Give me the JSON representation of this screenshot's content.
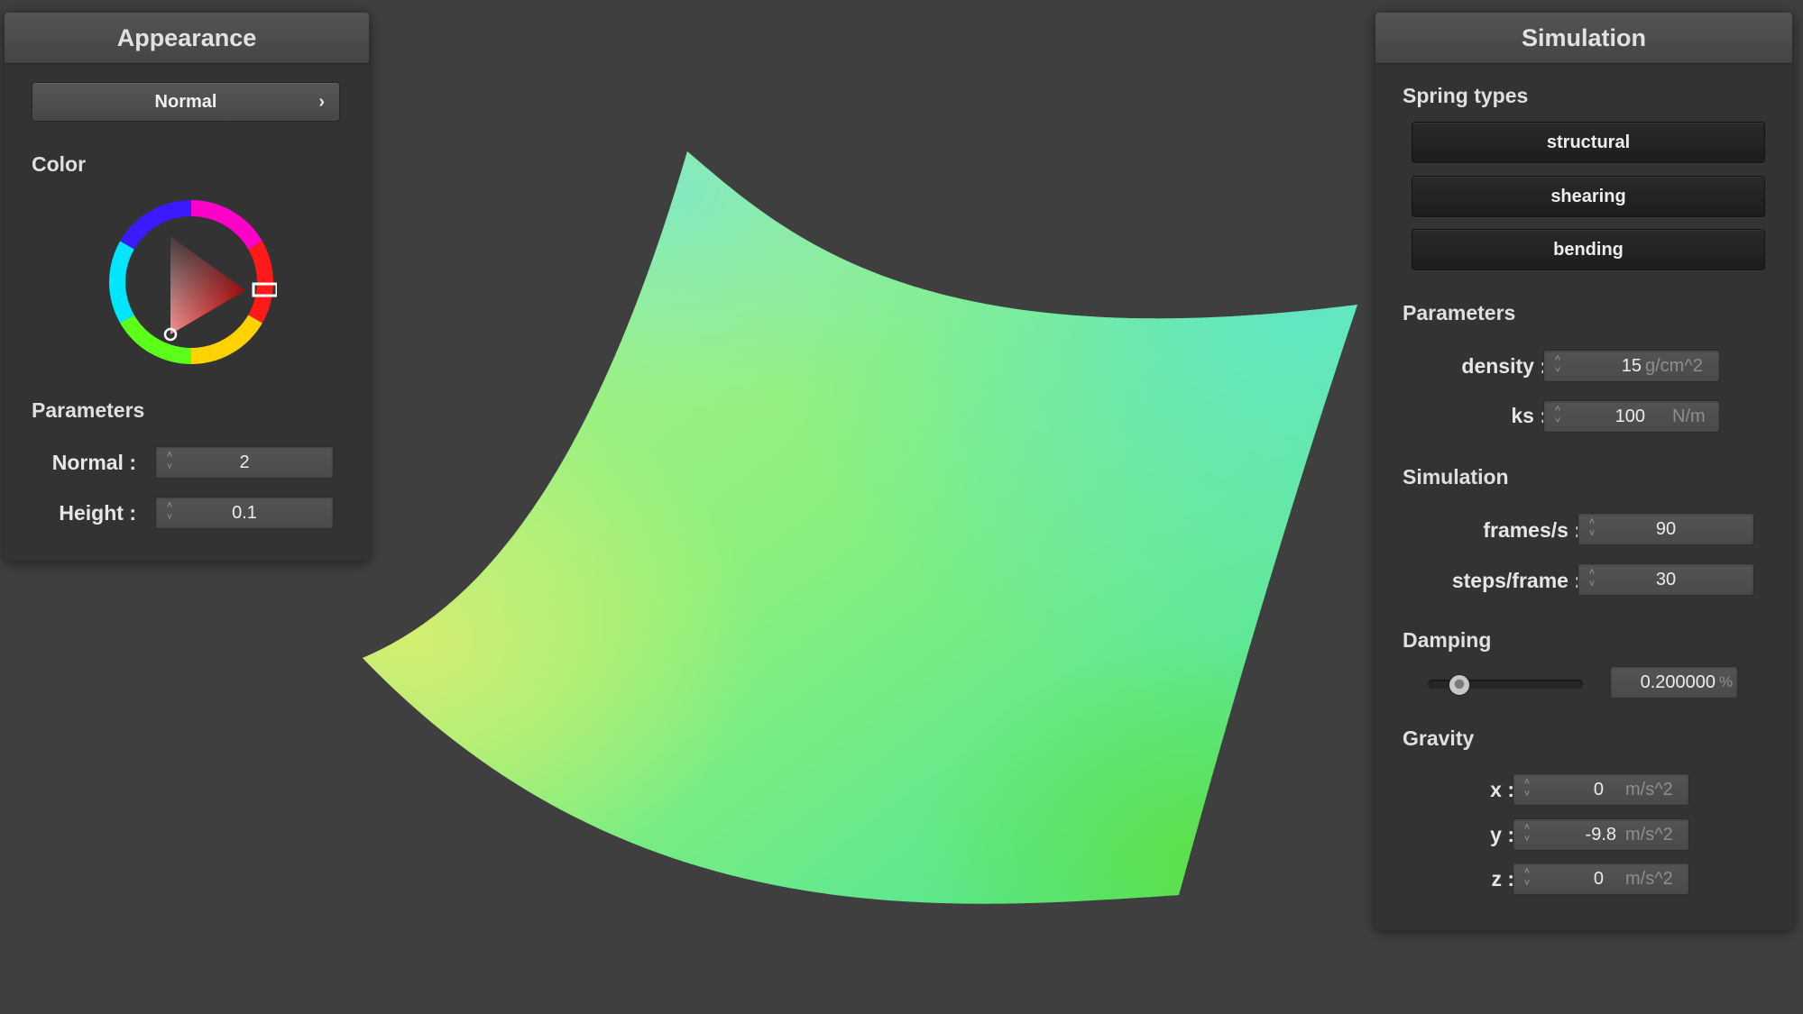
{
  "appearance": {
    "title": "Appearance",
    "shader_select": "Normal",
    "color_label": "Color",
    "selected_color": "#e61a1a",
    "parameters_label": "Parameters",
    "normal": {
      "label": "Normal :",
      "value": "2"
    },
    "height": {
      "label": "Height :",
      "value": "0.1"
    }
  },
  "simulation": {
    "title": "Simulation",
    "spring_types_label": "Spring types",
    "spring_buttons": [
      "structural",
      "shearing",
      "bending"
    ],
    "parameters_label": "Parameters",
    "density": {
      "label": "density :",
      "value": "15",
      "unit": "g/cm^2"
    },
    "ks": {
      "label": "ks :",
      "value": "100",
      "unit": "N/m"
    },
    "simulation_label": "Simulation",
    "frames": {
      "label": "frames/s :",
      "value": "90"
    },
    "steps": {
      "label": "steps/frame :",
      "value": "30"
    },
    "damping_label": "Damping",
    "damping": {
      "value": "0.200000",
      "unit": "%",
      "slider_fraction": 0.2
    },
    "gravity_label": "Gravity",
    "gravity_x": {
      "label": "x :",
      "value": "0",
      "unit": "m/s^2"
    },
    "gravity_y": {
      "label": "y :",
      "value": "-9.8",
      "unit": "m/s^2"
    },
    "gravity_z": {
      "label": "z :",
      "value": "0",
      "unit": "m/s^2"
    }
  },
  "colors": {
    "background": "#3f3f3f",
    "panel": "#333333",
    "cloth_light": "#b8f37a",
    "cloth_mid": "#74ee88",
    "cloth_teal": "#5fe0b8"
  }
}
